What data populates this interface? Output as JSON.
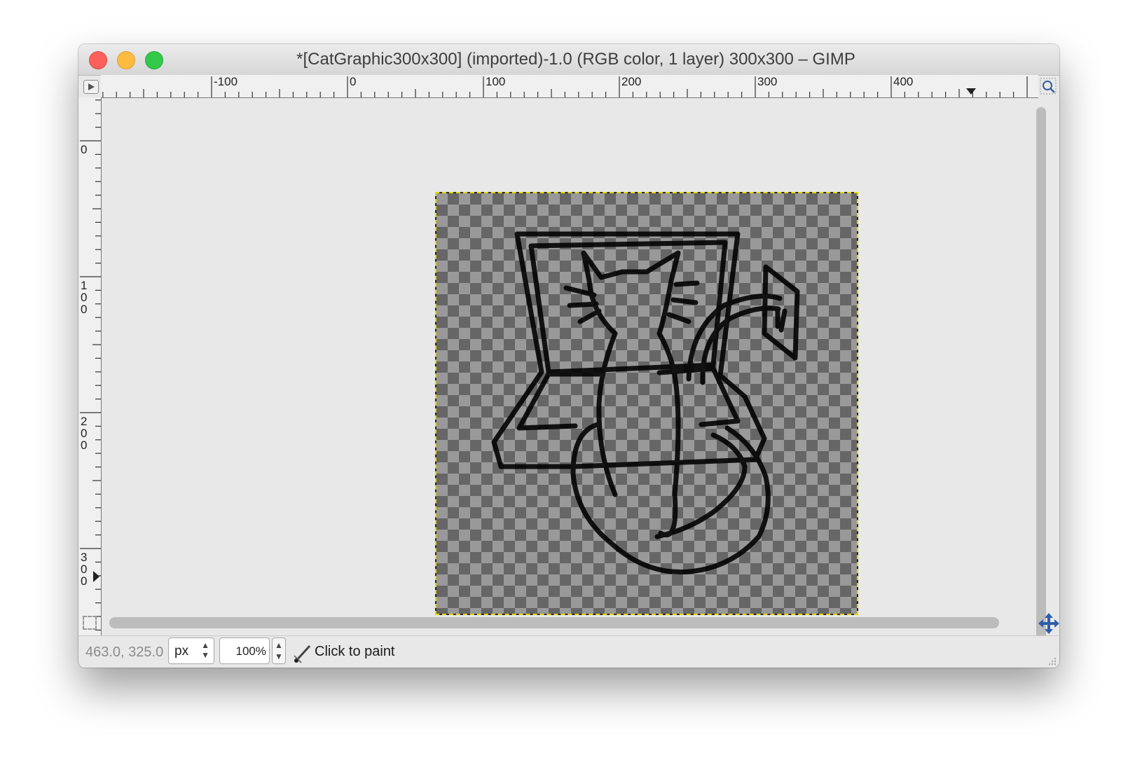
{
  "window": {
    "title": "*[CatGraphic300x300] (imported)-1.0 (RGB color, 1 layer) 300x300 – GIMP"
  },
  "hruler": {
    "labels": [
      "-100",
      "0",
      "100",
      "200",
      "300",
      "400"
    ]
  },
  "vruler": {
    "labels": [
      "0",
      "100",
      "200",
      "300"
    ]
  },
  "statusbar": {
    "coordinates": "463.0, 325.0",
    "unit": "px",
    "zoom": "100%",
    "message": "Click to paint"
  },
  "icons": {
    "navigate": "triangle-right-icon",
    "zoom": "zoom-icon",
    "quick_mask": "quick-mask-icon",
    "navigation": "move-cross-icon",
    "tool": "paintbrush-icon"
  },
  "colors": {
    "close": "#fc605c",
    "minimize": "#fdbc40",
    "maximize": "#34c84a",
    "selection_border": "#e5d800"
  }
}
